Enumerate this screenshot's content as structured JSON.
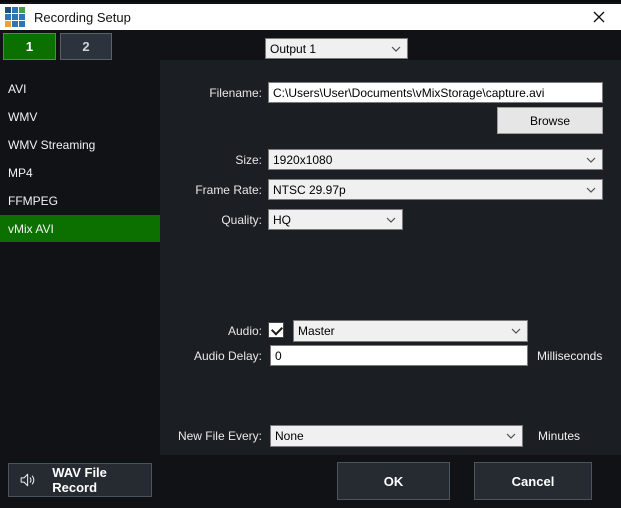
{
  "colors": {
    "body-bg": "#101216",
    "panel-bg": "#1b1e22",
    "titlebar-bg": "#ffffff",
    "accent-green": "#0c7000",
    "accent-green-border": "#2da521",
    "tab-inactive-bg": "#2d333c",
    "tab-inactive-border": "#5a6069",
    "button-dark-bg": "#262b32",
    "button-dark-border": "#4d545e",
    "logo-blue": "#2e75b6",
    "logo-darkblue": "#1f4e79",
    "logo-green": "#43a047",
    "logo-orange": "#f0a030"
  },
  "window": {
    "title": "Recording Setup"
  },
  "tabs": [
    {
      "label": "1",
      "active": true
    },
    {
      "label": "2",
      "active": false
    }
  ],
  "output_selector": {
    "value": "Output 1"
  },
  "sidebar": {
    "items": [
      {
        "label": "AVI",
        "selected": false
      },
      {
        "label": "WMV",
        "selected": false
      },
      {
        "label": "WMV Streaming",
        "selected": false
      },
      {
        "label": "MP4",
        "selected": false
      },
      {
        "label": "FFMPEG",
        "selected": false
      },
      {
        "label": "vMix AVI",
        "selected": true
      }
    ]
  },
  "form": {
    "filename": {
      "label": "Filename:",
      "value": "C:\\Users\\User\\Documents\\vMixStorage\\capture.avi"
    },
    "browse_button": "Browse",
    "size": {
      "label": "Size:",
      "value": "1920x1080"
    },
    "frame_rate": {
      "label": "Frame Rate:",
      "value": "NTSC 29.97p"
    },
    "quality": {
      "label": "Quality:",
      "value": "HQ"
    },
    "audio": {
      "label": "Audio:",
      "checked": true,
      "value": "Master"
    },
    "audio_delay": {
      "label": "Audio Delay:",
      "value": "0",
      "unit": "Milliseconds"
    },
    "new_file_every": {
      "label": "New File Every:",
      "value": "None",
      "unit": "Minutes"
    }
  },
  "footer": {
    "wav_button": "WAV File Record",
    "ok": "OK",
    "cancel": "Cancel"
  }
}
